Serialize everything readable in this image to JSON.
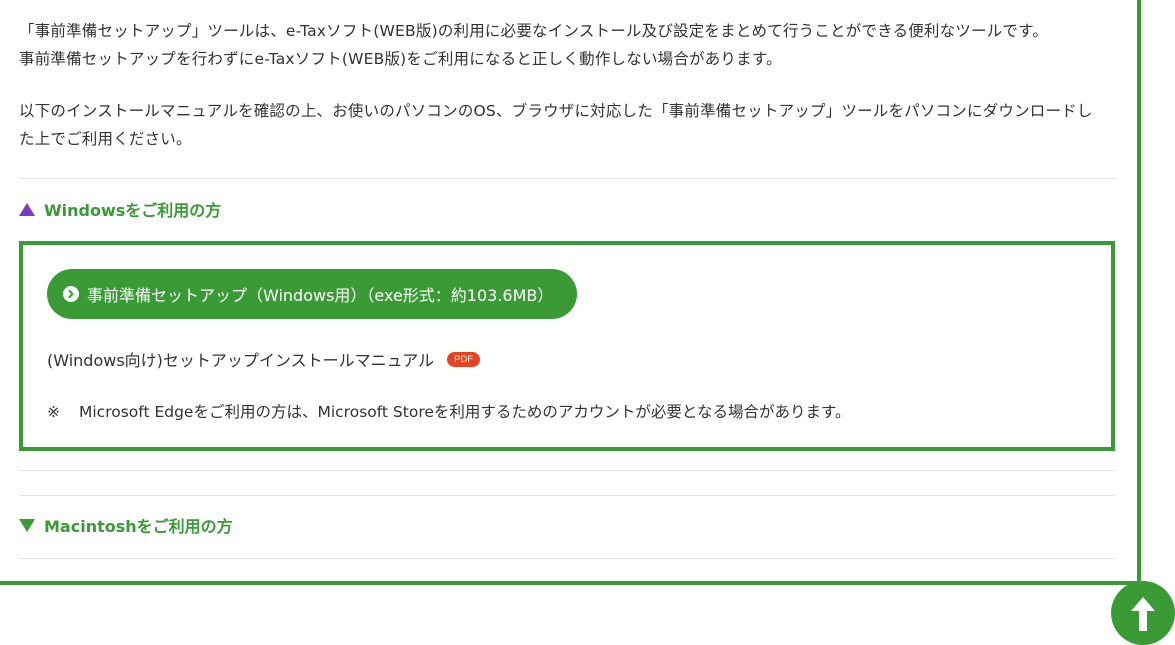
{
  "intro": {
    "line1": "「事前準備セットアップ」ツールは、e-Taxソフト(WEB版)の利用に必要なインストール及び設定をまとめて行うことができる便利なツールです。",
    "line2": "事前準備セットアップを行わずにe-Taxソフト(WEB版)をご利用になると正しく動作しない場合があります。",
    "line3": "以下のインストールマニュアルを確認の上、お使いのパソコンのOS、ブラウザに対応した「事前準備セットアップ」ツールをパソコンにダウンロードし",
    "line4": "た上でご利用ください。"
  },
  "windows_section": {
    "title": "Windowsをご利用の方",
    "state_icon": "triangle-up-icon",
    "download_button_label": "事前準備セットアップ（Windows用）（exe形式：約103.6MB）",
    "manual_link_label": "(Windows向け)セットアップインストールマニュアル",
    "pdf_badge": "PDF",
    "note_mark": "※",
    "note_text": "Microsoft Edgeをご利用の方は、Microsoft Storeを利用するためのアカウントが必要となる場合があります。"
  },
  "mac_section": {
    "title": "Macintoshをご利用の方",
    "state_icon": "triangle-down-icon"
  },
  "page_top_button": {
    "icon": "arrow-up-icon"
  },
  "colors": {
    "accent_green": "#3a9a35",
    "expanded_triangle_purple": "#7a3cc0",
    "pdf_badge_red": "#e8421e"
  }
}
